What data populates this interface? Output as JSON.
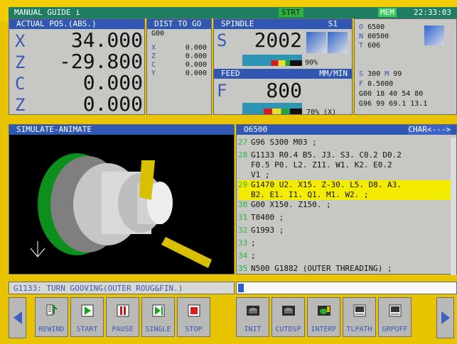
{
  "status": {
    "title": "MANUAL GUIDE i",
    "strt": "STRT",
    "mem": "MEM",
    "time": "22:33:03"
  },
  "actual": {
    "header": "ACTUAL POS.(ABS.)",
    "axes": [
      {
        "axis": "X",
        "value": "34.000"
      },
      {
        "axis": "Z",
        "value": "-29.800"
      },
      {
        "axis": "C",
        "value": "0.000"
      },
      {
        "axis": "Z",
        "value": "0.000"
      }
    ]
  },
  "dist": {
    "header": "DIST TO GO",
    "g": "G00",
    "rows": [
      {
        "axis": "X",
        "value": "0.000"
      },
      {
        "axis": "Z",
        "value": "0.000"
      },
      {
        "axis": "C",
        "value": "0.000"
      },
      {
        "axis": "Y",
        "value": "0.000"
      }
    ]
  },
  "spindle": {
    "header": "SPINDLE",
    "s1": "S1",
    "letter": "S",
    "value": "2002",
    "percent": "90%"
  },
  "feed": {
    "header": "FEED",
    "units": "MM/MIN",
    "letter": "F",
    "value": "800",
    "percent": "70% (X)"
  },
  "program_info": {
    "o": "6500",
    "n": "00500",
    "t": "606",
    "s": "300",
    "m": "99",
    "f": "0.5000",
    "g1": "G00 18 40 54 80",
    "g2": "G96 99 69.1  13.1"
  },
  "simulate": {
    "header": "SIMULATE-ANIMATE",
    "status": "G1133: TURN GOOVING(OUTER ROUG&FIN.)"
  },
  "program": {
    "header": "O6500",
    "char": "CHAR<--->",
    "lines": [
      {
        "n": "27",
        "text": "G96 S300 M03 ;"
      },
      {
        "n": "28",
        "text": "G1133 R0.4 B5. J3. S3. C0.2 D0.2\nF0.5 P0. L2. Z11. W1. K2. E0.2\nV1 ;"
      },
      {
        "n": "29",
        "text": "G1470 U2. X15. Z-30. L5. D8. A3.\nB2. E1. I1. Q1. M1. W2. ;"
      },
      {
        "n": "30",
        "text": "G00 X150. Z150. ;"
      },
      {
        "n": "31",
        "text": "T0400 ;"
      },
      {
        "n": "32",
        "text": "G1993 ;"
      },
      {
        "n": "33",
        "text": ";"
      },
      {
        "n": "34",
        "text": ";"
      },
      {
        "n": "35",
        "text": "N500 G1882 (OUTER THREADING) ;"
      }
    ]
  },
  "soft_buttons": [
    {
      "label": "REWIND",
      "icon": "rewind-icon"
    },
    {
      "label": "START",
      "icon": "start-icon"
    },
    {
      "label": "PAUSE",
      "icon": "pause-icon"
    },
    {
      "label": "SINGLE",
      "icon": "single-icon"
    },
    {
      "label": "STOP",
      "icon": "stop-icon"
    },
    {
      "label": "INIT",
      "icon": "init-icon"
    },
    {
      "label": "CUTDSP",
      "icon": "cutdsp-icon"
    },
    {
      "label": "INTERF",
      "icon": "interf-icon"
    },
    {
      "label": "TLPATH",
      "icon": "tlpath-icon"
    },
    {
      "label": "GRPOFF",
      "icon": "grpoff-icon"
    }
  ]
}
